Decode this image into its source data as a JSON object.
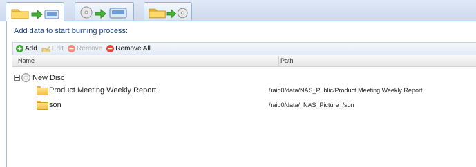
{
  "tabs": [
    {
      "icon": "folder-to-disc-icon"
    },
    {
      "icon": "disc-to-disc-icon"
    },
    {
      "icon": "folder-to-image-icon"
    }
  ],
  "panel": {
    "prompt": "Add data to start burning process:"
  },
  "toolbar": {
    "add_label": "Add",
    "edit_label": "Edit",
    "remove_label": "Remove",
    "remove_all_label": "Remove All"
  },
  "columns": {
    "name": "Name",
    "path": "Path"
  },
  "tree": {
    "root_label": "New Disc",
    "items": [
      {
        "name": "Product Meeting Weekly Report",
        "path": "/raid0/data/NAS_Public/Product Meeting Weekly Report"
      },
      {
        "name": "son",
        "path": "/raid0/data/_NAS_Picture_/son"
      }
    ]
  },
  "colors": {
    "accent": "#15428b",
    "border": "#99bbe8",
    "add_green": "#3aa52f",
    "remove_red": "#e04a3a"
  }
}
